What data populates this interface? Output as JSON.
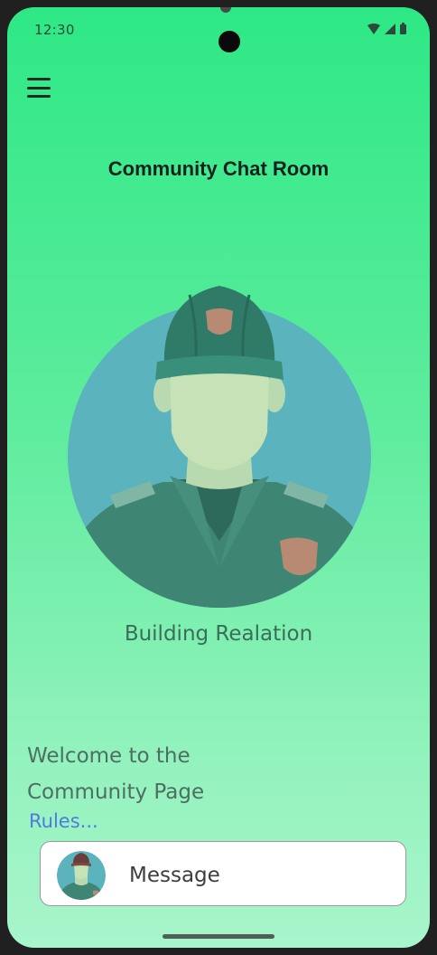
{
  "status_bar": {
    "time": "12:30",
    "icons": [
      "wifi-icon",
      "signal-icon",
      "battery-icon"
    ]
  },
  "header": {
    "menu_icon": "hamburger-menu-icon",
    "title": "Community Chat Room"
  },
  "hero": {
    "avatar": "police-officer-avatar",
    "subtitle": "Building Realation"
  },
  "welcome": {
    "line1": "Welcome to the",
    "line2": "Community Page",
    "rules_link": "Rules..."
  },
  "composer": {
    "avatar": "police-officer-avatar-small",
    "placeholder": "Message"
  },
  "colors": {
    "gradient_top": "#2ee885",
    "gradient_bottom": "#a8f5cb",
    "link": "#4f7be0",
    "avatar_circle": "#5bb3be",
    "uniform": "#3f8574"
  }
}
